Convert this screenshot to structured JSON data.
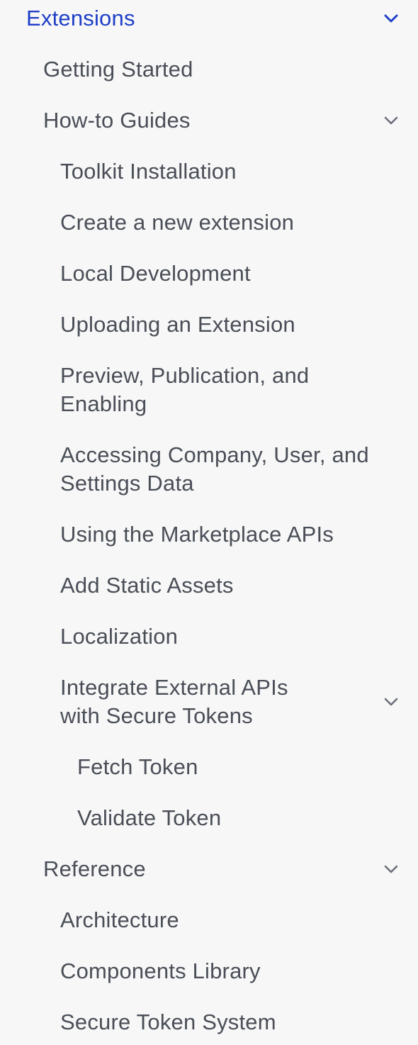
{
  "nav": {
    "extensions": {
      "label": "Extensions",
      "icon": "chevron-down-icon",
      "color": "#1f3fc7"
    },
    "getting_started": {
      "label": "Getting Started"
    },
    "how_to_guides": {
      "label": "How-to Guides",
      "icon": "chevron-down-icon",
      "items": {
        "toolkit_installation": "Toolkit Installation",
        "create_extension": "Create a new extension",
        "local_development": "Local Development",
        "uploading_extension": "Uploading an Extension",
        "preview_publication_line1": "Preview, Publication, and",
        "preview_publication_line2": "Enabling",
        "accessing_data_line1": "Accessing Company, User, and",
        "accessing_data_line2": "Settings Data",
        "marketplace_apis": "Using the Marketplace APIs",
        "static_assets": "Add Static Assets",
        "localization": "Localization",
        "integrate_apis_line1": "Integrate External APIs",
        "integrate_apis_line2": "with Secure Tokens",
        "fetch_token": "Fetch Token",
        "validate_token": "Validate Token"
      }
    },
    "reference": {
      "label": "Reference",
      "icon": "chevron-down-icon",
      "items": {
        "architecture": "Architecture",
        "components_library": "Components Library",
        "secure_token_system": "Secure Token System"
      }
    }
  }
}
